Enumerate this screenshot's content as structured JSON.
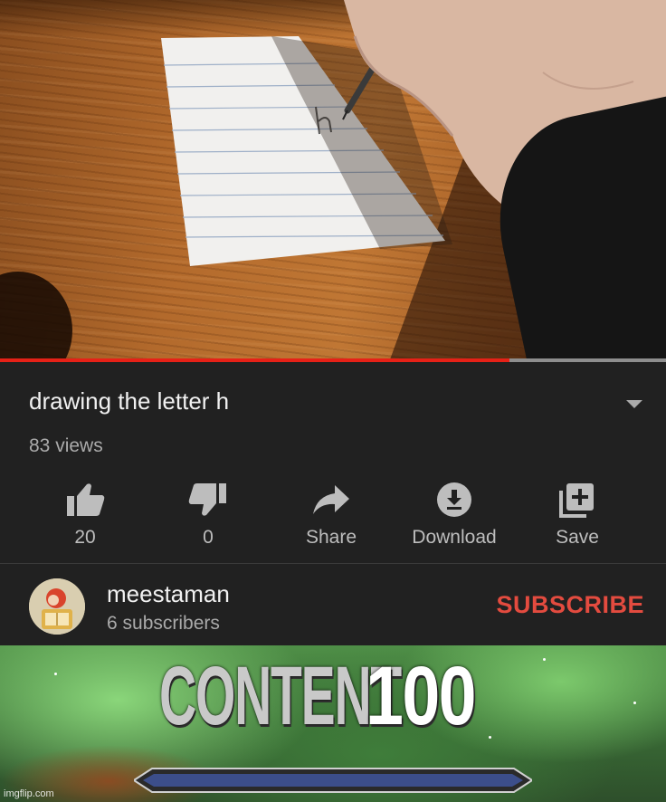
{
  "video": {
    "progress_fraction": 0.765,
    "progress_color": "#e62117",
    "remaining_color": "#8e8e8e"
  },
  "info": {
    "title": "drawing the letter h",
    "views": "83 views",
    "expand_icon": "chevron-down-icon"
  },
  "actions": [
    {
      "id": "like",
      "icon": "thumbs-up-icon",
      "label": "20"
    },
    {
      "id": "dislike",
      "icon": "thumbs-down-icon",
      "label": "0"
    },
    {
      "id": "share",
      "icon": "share-arrow-icon",
      "label": "Share"
    },
    {
      "id": "download",
      "icon": "download-icon",
      "label": "Download"
    },
    {
      "id": "save",
      "icon": "playlist-add-icon",
      "label": "Save"
    }
  ],
  "channel": {
    "name": "meestaman",
    "subscribers": "6 subscribers",
    "subscribe_label": "SUBSCRIBE",
    "subscribe_color": "#e34b3f"
  },
  "banner": {
    "word": "CONTENT",
    "value": "100",
    "watermark": "imgflip.com"
  },
  "colors": {
    "background": "#212121",
    "text_primary": "#f1f1f1",
    "text_secondary": "#aaaaaa"
  }
}
